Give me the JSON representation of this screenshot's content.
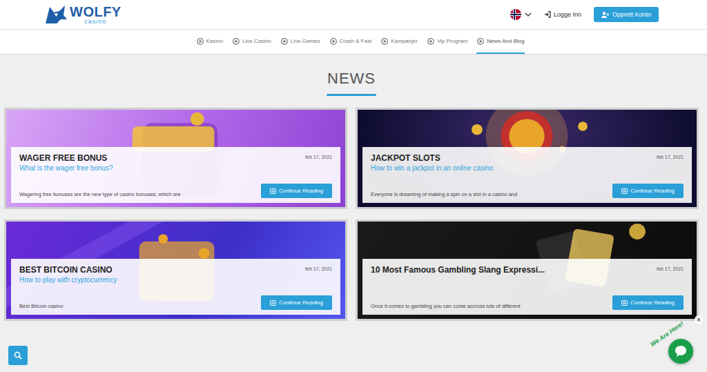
{
  "header": {
    "logo": {
      "name": "WOLFY",
      "sub": "casino"
    },
    "login": "Logge Inn",
    "signup": "Opprett Konto"
  },
  "nav": [
    {
      "label": "Kasino",
      "selected": false
    },
    {
      "label": "Live Casino",
      "selected": false
    },
    {
      "label": "Live Games",
      "selected": false
    },
    {
      "label": "Crash & Fast",
      "selected": false
    },
    {
      "label": "Kampanjer",
      "selected": false
    },
    {
      "label": "Vip Program",
      "selected": false
    },
    {
      "label": "News And Blog",
      "selected": true
    }
  ],
  "section_title": "NEWS",
  "cards": [
    {
      "kind": "bonus",
      "title": "WAGER FREE BONUS",
      "date": "feb 17, 2021",
      "subtitle": "What is the wager free bonus?",
      "excerpt": "Wagering free bonuses are the new type of casino bonuses, which are",
      "button": "Continue Reading"
    },
    {
      "kind": "jackpot",
      "title": "JACKPOT SLOTS",
      "date": "feb 17, 2021",
      "subtitle": "How to win a jackpot in an online casino",
      "excerpt": "Everyone is dreaming of making a spin on a slot in a casino and",
      "button": "Continue Reading"
    },
    {
      "kind": "bitcoin",
      "title": "BEST BITCOIN CASINO",
      "date": "feb 17, 2021",
      "subtitle": "How to play with cryptocurrency",
      "excerpt": "Best Bitcoin casino",
      "button": "Continue Reading"
    },
    {
      "kind": "slang",
      "title": "10 Most Famous Gambling Slang Expressi...",
      "date": "feb 17, 2021",
      "excerpt": "Once it comes to gambling you can come accross lots of different",
      "button": "Continue Reading"
    }
  ],
  "chat": {
    "label": "We Are Here!",
    "close": "×"
  }
}
